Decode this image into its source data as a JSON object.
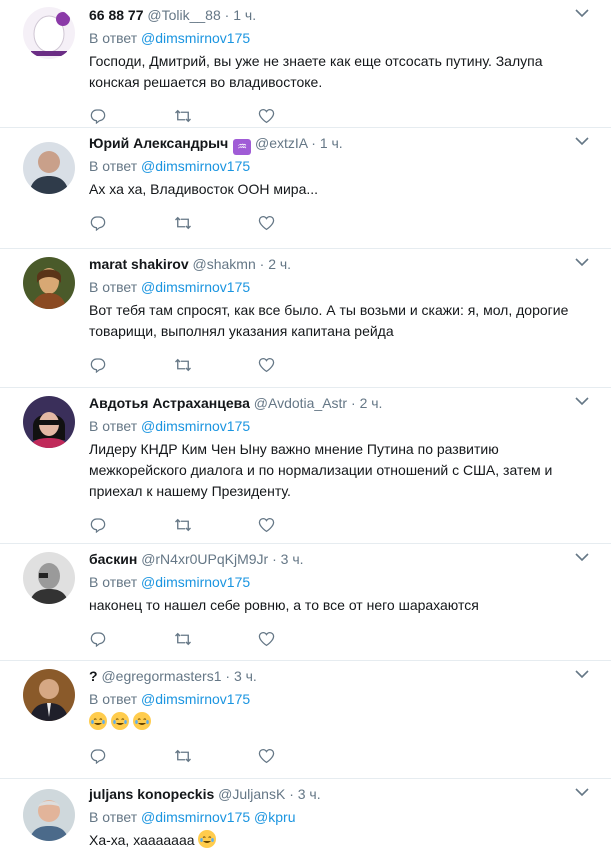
{
  "reply_prefix": "В ответ",
  "tweets": [
    {
      "name": "66 88 77",
      "handle": "@Tolik__88",
      "time": "1 ч.",
      "mentions": "@dimsmirnov175",
      "text": "Господи, Дмитрий, вы уже не знаете как еще отсосать путину. Залупа конская решается во владивостоке.",
      "avatar_icon": "egg-avatar"
    },
    {
      "name": "Юрий Александрыч",
      "name_badge": "♒",
      "handle": "@extzIA",
      "time": "1 ч.",
      "mentions": "@dimsmirnov175",
      "text": "Ах ха ха, Владивосток ООН мира...",
      "avatar_icon": "man-photo-avatar"
    },
    {
      "name": "marat shakirov",
      "handle": "@shakmn",
      "time": "2 ч.",
      "mentions": "@dimsmirnov175",
      "text": "Вот тебя там спросят, как все было. А ты возьми и скажи: я, мол, дорогие товарищи, выполнял указания капитана рейда",
      "avatar_icon": "painting-avatar"
    },
    {
      "name": "Авдотья Астраханцева",
      "handle": "@Avdotia_Astr",
      "time": "2 ч.",
      "mentions": "@dimsmirnov175",
      "text": "Лидеру КНДР Ким Чен Ыну важно мнение Путина по развитию межкорейского диалога и по нормализации отношений с США, затем и приехал к нашему Президенту.",
      "avatar_icon": "woman-sunglasses-avatar"
    },
    {
      "name": "баскин",
      "handle": "@rN4xr0UPqKjM9Jr",
      "time": "3 ч.",
      "mentions": "@dimsmirnov175",
      "text": "наконец то нашел себе ровню, а то все от него шарахаются",
      "avatar_icon": "bw-portrait-avatar"
    },
    {
      "name": "?",
      "handle": "@egregormasters1",
      "time": "3 ч.",
      "mentions": "@dimsmirnov175",
      "text": "",
      "emoji_count": 3,
      "avatar_icon": "man-suit-avatar"
    },
    {
      "name": "juljans konopeckis",
      "handle": "@JuljansK",
      "time": "3 ч.",
      "mentions": "@dimsmirnov175 @kpru",
      "text": "Ха-ха, хааааааа",
      "emoji_count": 1,
      "avatar_icon": "old-man-avatar"
    }
  ],
  "colors": {
    "link": "#1b95e0",
    "meta": "#657786",
    "divider": "#e6ecf0"
  }
}
